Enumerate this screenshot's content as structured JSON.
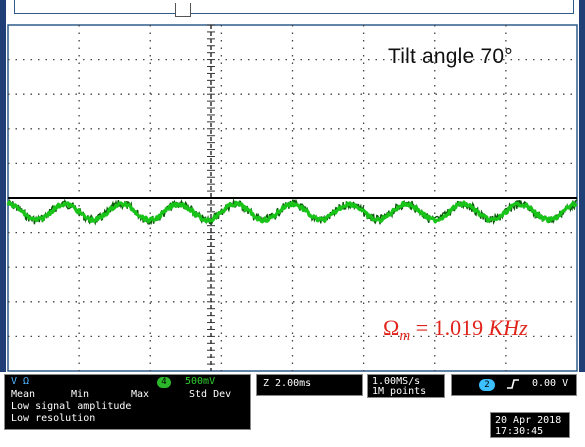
{
  "annotations": {
    "tilt_label": "Tilt angle 70°",
    "freq_symbol": "Ω",
    "freq_subscript": "m",
    "freq_equals": " = 1.019 ",
    "freq_unit": "KHz"
  },
  "channel_panel": {
    "units": "V  Ω",
    "channel_number": "4",
    "scale": "500mV",
    "stat_headers": [
      "Mean",
      "Min",
      "Max",
      "Std Dev"
    ],
    "warning_1": "Low signal amplitude",
    "warning_2": "Low resolution"
  },
  "timebase": {
    "label": "Z 2.00ms"
  },
  "acquisition": {
    "sample_rate": "1.00MS/s",
    "record_length": "1M points"
  },
  "trigger": {
    "source": "2",
    "slope_icon": "rising-edge-icon",
    "level": "0.00 V"
  },
  "timestamp": {
    "date": "20 Apr 2018",
    "time": "17:30:45"
  },
  "colors": {
    "trace": "#18c418",
    "trace_dark": "#0a5a0a",
    "grid_dots": "#444444",
    "frame": "#1f3f76",
    "annotation_red": "#e0241b"
  },
  "waveform": {
    "cycles_on_screen": 10
  }
}
